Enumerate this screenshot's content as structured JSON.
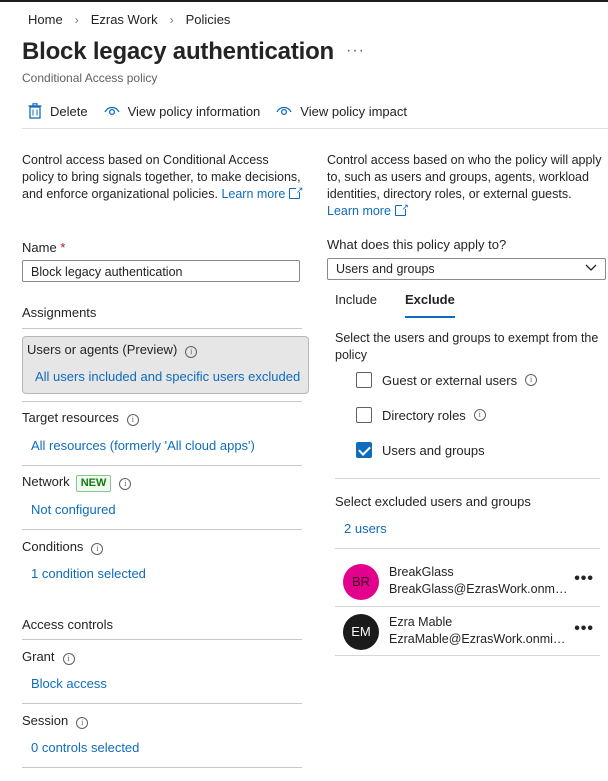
{
  "breadcrumb": {
    "items": [
      "Home",
      "Ezras Work",
      "Policies"
    ]
  },
  "header": {
    "title": "Block legacy authentication",
    "subtitle": "Conditional Access policy",
    "more": "···"
  },
  "toolbar": {
    "delete_label": "Delete",
    "view_info_label": "View policy information",
    "view_impact_label": "View policy impact"
  },
  "left": {
    "description": "Control access based on Conditional Access policy to bring signals together, to make decisions, and enforce organizational policies.",
    "learn_more": "Learn more",
    "name_label": "Name",
    "required_mark": "*",
    "name_value": "Block legacy authentication",
    "assignments_heading": "Assignments",
    "users": {
      "title": "Users or agents (Preview)",
      "value": "All users included and specific users excluded"
    },
    "target": {
      "title": "Target resources",
      "value": "All resources (formerly 'All cloud apps')"
    },
    "network": {
      "title": "Network",
      "badge": "NEW",
      "value": "Not configured"
    },
    "conditions": {
      "title": "Conditions",
      "value": "1 condition selected"
    },
    "access_controls_heading": "Access controls",
    "grant": {
      "title": "Grant",
      "value": "Block access"
    },
    "session": {
      "title": "Session",
      "value": "0 controls selected"
    }
  },
  "right": {
    "description": "Control access based on who the policy will apply to, such as users and groups, agents, workload identities, directory roles, or external guests.",
    "learn_more": "Learn more",
    "apply_label": "What does this policy apply to?",
    "apply_value": "Users and groups",
    "tabs": [
      "Include",
      "Exclude"
    ],
    "exempt_label": "Select the users and groups to exempt from the policy",
    "checkboxes": [
      {
        "label": "Guest or external users",
        "checked": false
      },
      {
        "label": "Directory roles",
        "checked": false
      },
      {
        "label": "Users and groups",
        "checked": true
      }
    ],
    "excluded_label": "Select excluded users and groups",
    "count_link": "2 users",
    "users": [
      {
        "initials": "BR",
        "name": "BreakGlass",
        "email": "BreakGlass@EzrasWork.onmicrosoft.com",
        "color": "#e3008c"
      },
      {
        "initials": "EM",
        "name": "Ezra Mable",
        "email": "EzraMable@EzrasWork.onmicrosoft.com",
        "color": "#1b1b1b"
      }
    ],
    "row_more": "•••"
  }
}
